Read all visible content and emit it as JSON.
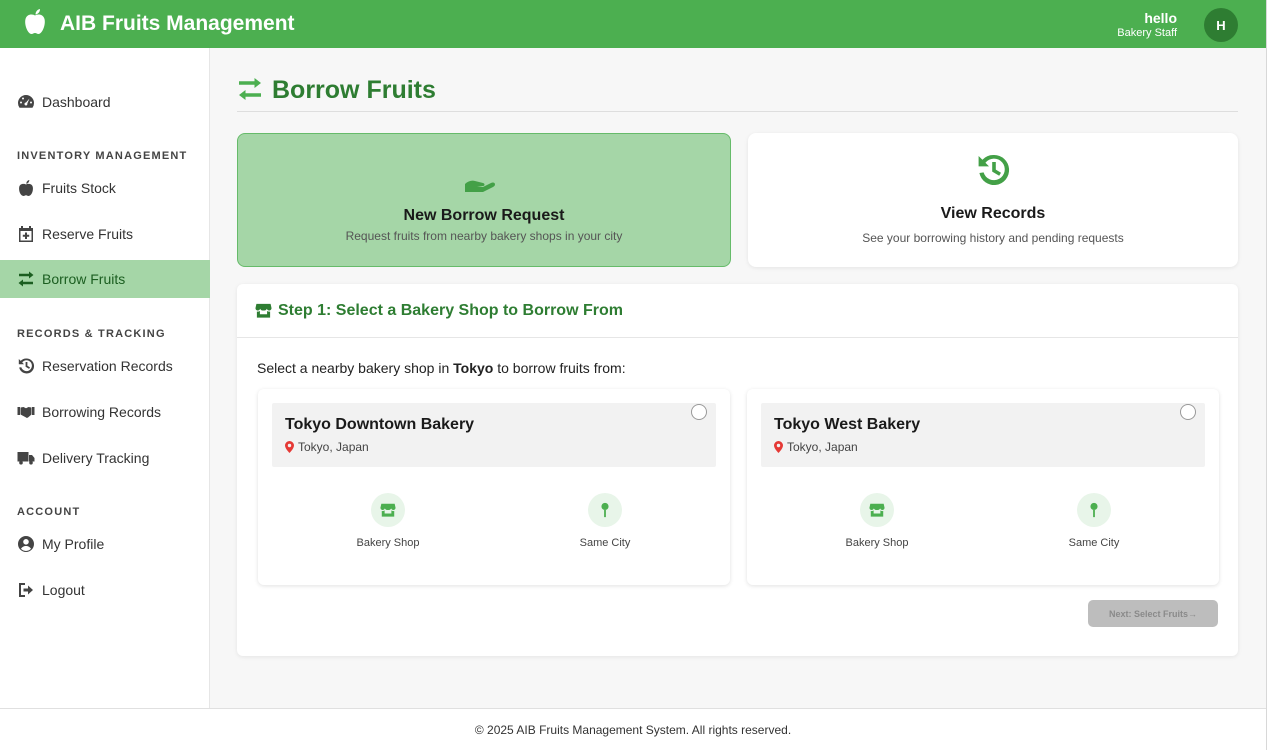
{
  "header": {
    "title": "AIB Fruits Management",
    "user_name": "hello",
    "user_role": "Bakery Staff",
    "avatar_initial": "H",
    "brand_color": "#4caf50"
  },
  "sidebar": {
    "dashboard": "Dashboard",
    "section_inventory": "INVENTORY MANAGEMENT",
    "fruits_stock": "Fruits Stock",
    "reserve_fruits": "Reserve Fruits",
    "borrow_fruits": "Borrow Fruits",
    "section_records": "RECORDS & TRACKING",
    "reservation_records": "Reservation Records",
    "borrowing_records": "Borrowing Records",
    "delivery_tracking": "Delivery Tracking",
    "section_account": "ACCOUNT",
    "my_profile": "My Profile",
    "logout": "Logout"
  },
  "page": {
    "title": "Borrow Fruits"
  },
  "options": {
    "new_title": "New Borrow Request",
    "new_desc": "Request fruits from nearby bakery shops in your city",
    "records_title": "View Records",
    "records_desc": "See your borrowing history and pending requests"
  },
  "step": {
    "title": "Step 1: Select a Bakery Shop to Borrow From",
    "intro_before": "Select a nearby bakery shop in ",
    "intro_city": "Tokyo",
    "intro_after": " to borrow fruits from:",
    "next_button": "Next: Select Fruits→"
  },
  "shops": [
    {
      "name": "Tokyo Downtown Bakery",
      "location": "Tokyo, Japan",
      "feature_1": "Bakery Shop",
      "feature_2": "Same City"
    },
    {
      "name": "Tokyo West Bakery",
      "location": "Tokyo, Japan",
      "feature_1": "Bakery Shop",
      "feature_2": "Same City"
    }
  ],
  "footer": {
    "text": "© 2025 AIB Fruits Management System. All rights reserved."
  }
}
